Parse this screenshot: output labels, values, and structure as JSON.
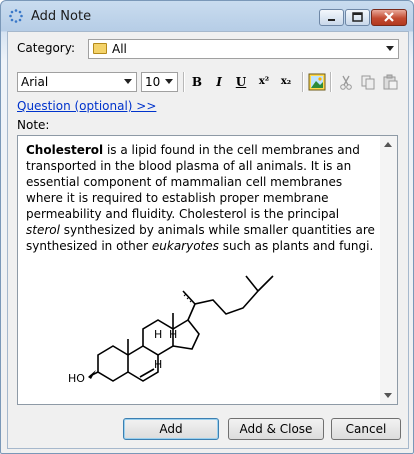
{
  "window": {
    "title": "Add Note"
  },
  "category": {
    "label": "Category:",
    "value": "All"
  },
  "toolbar": {
    "font": "Arial",
    "size": "10",
    "bold_icon": "B",
    "italic_icon": "I",
    "underline_icon": "U",
    "superscript_icon": "x²",
    "subscript_icon": "x₂"
  },
  "question_link": "Question (optional) >>",
  "note": {
    "label": "Note:",
    "bold_word": "Cholesterol",
    "text_1": " is a lipid found in the cell membranes and transported in the blood plasma of all animals. It is an essential component of mammalian cell membranes where it is required to establish proper membrane permeability and fluidity. Cholesterol is the principal ",
    "italic_1": "sterol",
    "text_2": " synthesized by animals while smaller quantities are synthesized in other ",
    "italic_2": "eukaryotes",
    "text_3": " such as plants and fungi.",
    "structure_labels": {
      "h": "H",
      "ho": "HO"
    }
  },
  "buttons": {
    "add": "Add",
    "add_close": "Add & Close",
    "cancel": "Cancel"
  }
}
